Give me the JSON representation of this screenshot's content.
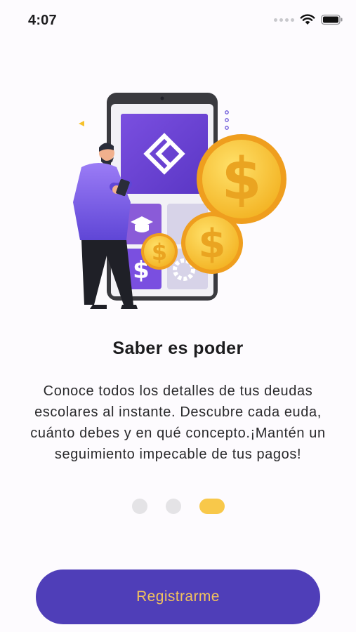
{
  "status_bar": {
    "time": "4:07",
    "icons": [
      "signal-dots-icon",
      "wifi-icon",
      "battery-icon"
    ]
  },
  "onboarding": {
    "illustration": "person-phone-coins-illustration",
    "title": "Saber es poder",
    "description": "Conoce todos los detalles de tus deudas escolares al instante. Descubre cada euda, cuánto debes y en qué concepto.¡Mantén un seguimiento impecable de tus pagos!",
    "pager": {
      "total": 3,
      "active_index": 2
    }
  },
  "actions": {
    "register_label": "Registrarme"
  },
  "colors": {
    "primary": "#4f3eb8",
    "accent": "#f8c84a",
    "button_text": "#f2c25d",
    "background": "#fdfbfe",
    "inactive_dot": "#e4e3e6"
  }
}
